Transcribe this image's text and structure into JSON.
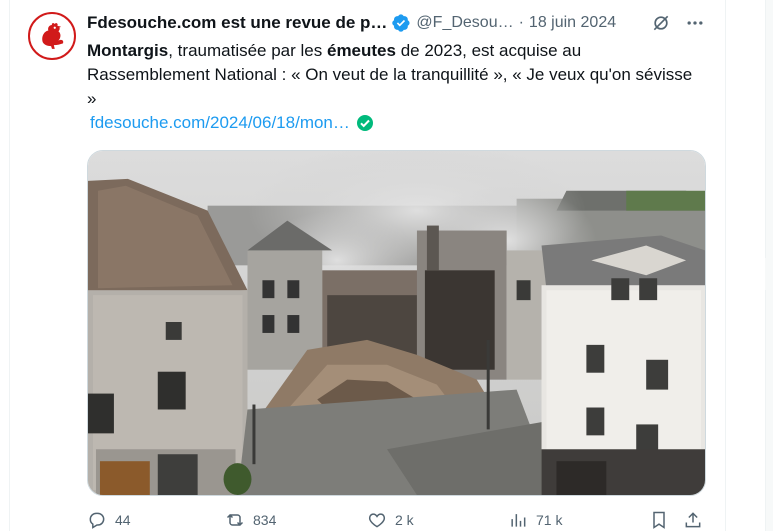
{
  "tweet": {
    "author_name": "Fdesouche.com est une revue de p…",
    "author_handle": "@F_Desou…",
    "separator": "·",
    "date": "18 juin 2024",
    "text_parts": [
      {
        "text": "Montargis",
        "bold": true
      },
      {
        "text": ", traumatisée par les ",
        "bold": false
      },
      {
        "text": "émeutes",
        "bold": true
      },
      {
        "text": " de 2023, est acquise au Rassemblement National : « On veut de la tranquillité », « Je veux qu'on sévisse »",
        "bold": false
      }
    ],
    "link_text": "fdesouche.com/2024/06/18/mon…",
    "image_alt": "Aerial view of collapsed, burned buildings on a street corner with smoke rising"
  },
  "actions": {
    "replies": "44",
    "retweets": "834",
    "likes": "2 k",
    "views": "71 k"
  },
  "colors": {
    "text": "#0f1419",
    "muted": "#536471",
    "link": "#1d9bf0",
    "verified": "#1d9bf0",
    "avatar_red": "#d11a1a"
  },
  "icons": [
    "rooster-logo-icon",
    "verified-badge-icon",
    "grok-icon",
    "more-icon",
    "link-verified-icon",
    "reply-icon",
    "retweet-icon",
    "like-icon",
    "views-icon",
    "bookmark-icon",
    "share-icon"
  ]
}
